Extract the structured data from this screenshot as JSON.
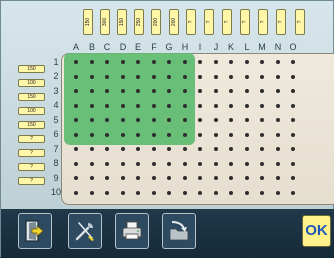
{
  "column_tags": [
    "150",
    "300",
    "150",
    "250",
    "200",
    "200",
    "?",
    "?",
    "?",
    "?",
    "?",
    "?",
    "?"
  ],
  "column_letters": [
    "A",
    "B",
    "C",
    "D",
    "E",
    "F",
    "G",
    "H",
    "I",
    "J",
    "K",
    "L",
    "M",
    "N",
    "O"
  ],
  "row_tags": [
    "150",
    "100",
    "150",
    "100",
    "150",
    "?",
    "?",
    "?",
    "?"
  ],
  "row_numbers": [
    "1",
    "2",
    "3",
    "4",
    "5",
    "6",
    "7",
    "8",
    "9",
    "10"
  ],
  "selection": {
    "from_column": "A",
    "to_column": "G",
    "from_row": "1",
    "to_row": "6",
    "color": "#62bd73"
  },
  "toolbar": {
    "buttons": [
      {
        "icon": "exit-door-icon"
      },
      {
        "icon": "tools-icon"
      },
      {
        "icon": "printer-icon"
      },
      {
        "icon": "folder-redirect-icon"
      }
    ],
    "ok_label": "OK"
  },
  "colors": {
    "tag_fill": "#fff6a8",
    "ok_text": "#1f57b8",
    "toolbar_bg": "#1c3446"
  }
}
